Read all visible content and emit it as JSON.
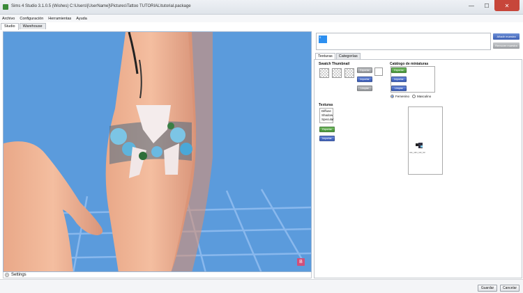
{
  "window": {
    "title": "Sims 4 Studio 3.1.0.5 (Wishes)  C:\\Users\\[UserName]\\Pictures\\Tattoo TUTORIAL\\tutorial.package",
    "app_icon": "sims4studio-icon",
    "controls": {
      "minimize": "—",
      "maximize": "☐",
      "close": "✕"
    }
  },
  "menu": [
    "Archivo",
    "Configuración",
    "Herramientas",
    "Ayuda"
  ],
  "main_tabs": {
    "studio": "Studio",
    "warehouse": "Warehouse",
    "active": "Studio"
  },
  "viewport": {
    "badge": "B",
    "background_color": "#5b9bdc"
  },
  "settings_bar": {
    "label": "Settings",
    "icon": "chevron-down-icon"
  },
  "right_panel": {
    "thumbnail_index": "0",
    "add_swatch_button": "Añadir muestra",
    "remove_swatch_button": "Remover muestra",
    "tabs": {
      "textures": "Texturas",
      "categories": "Categorías",
      "active": "Texturas"
    },
    "swatch_thumbnail": {
      "title": "Swatch Thumbnail",
      "export_button": "Exportar",
      "import_button": "Importar",
      "clear_button": "Limpiar"
    },
    "thumbnail_catalog": {
      "title": "Catálogo de miniaturas",
      "export_button": "Exportar",
      "import_button": "Importar",
      "clear_button": "Limpiar",
      "female_option": "Femenino",
      "male_option": "Masculino",
      "selected": "Femenino"
    },
    "textures": {
      "title": "Texturas",
      "items": [
        "Diffuse",
        "Shadow",
        "Specular"
      ],
      "export_button": "Exportar",
      "import_button": "Importar",
      "preview_caption": "cas_skin_tatt_lwr"
    }
  },
  "footer": {
    "save_button": "Guardar",
    "cancel_button": "Cancelar"
  }
}
